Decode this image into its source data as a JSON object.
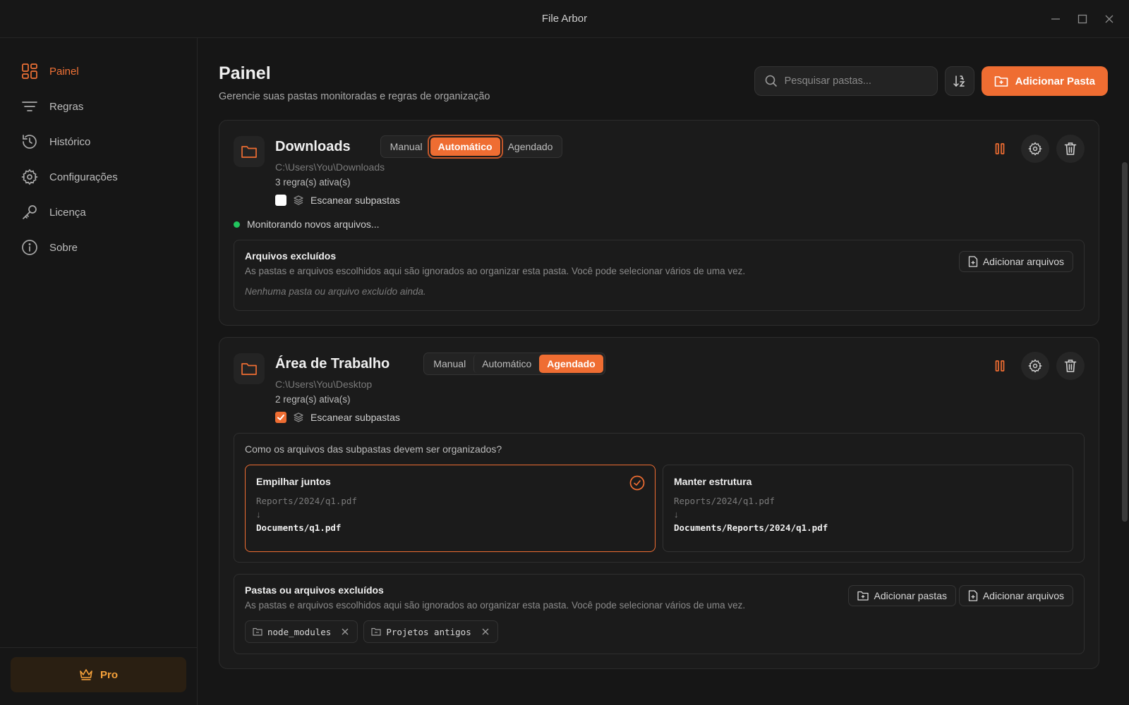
{
  "window": {
    "title": "File Arbor"
  },
  "sidebar": {
    "items": [
      {
        "label": "Painel",
        "icon": "dashboard-icon",
        "active": true
      },
      {
        "label": "Regras",
        "icon": "filter-icon"
      },
      {
        "label": "Histórico",
        "icon": "history-icon"
      },
      {
        "label": "Configurações",
        "icon": "gear-icon"
      },
      {
        "label": "Licença",
        "icon": "key-icon"
      },
      {
        "label": "Sobre",
        "icon": "info-icon"
      }
    ],
    "pro_label": "Pro"
  },
  "header": {
    "title": "Painel",
    "subtitle": "Gerencie suas pastas monitoradas e regras de organização",
    "search_placeholder": "Pesquisar pastas...",
    "add_label": "Adicionar Pasta"
  },
  "modes": [
    "Manual",
    "Automático",
    "Agendado"
  ],
  "folders": [
    {
      "name": "Downloads",
      "active_mode": "Automático",
      "path": "C:\\Users\\You\\Downloads",
      "rules": "3 regra(s) ativa(s)",
      "scan_label": "Escanear subpastas",
      "scan_checked": false,
      "status": "Monitorando novos arquivos...",
      "excluded": {
        "title": "Arquivos excluídos",
        "desc": "As pastas e arquivos escolhidos aqui são ignorados ao organizar esta pasta. Você pode selecionar vários de uma vez.",
        "empty": "Nenhuma pasta ou arquivo excluído ainda.",
        "add_files": "Adicionar arquivos"
      }
    },
    {
      "name": "Área de Trabalho",
      "active_mode": "Agendado",
      "path": "C:\\Users\\You\\Desktop",
      "rules": "2 regra(s) ativa(s)",
      "scan_label": "Escanear subpastas",
      "scan_checked": true,
      "subfolder": {
        "question": "Como os arquivos das subpastas devem ser organizados?",
        "options": [
          {
            "title": "Empilhar juntos",
            "from": "Reports/2024/q1.pdf",
            "arrow": "↓",
            "to": "Documents/q1.pdf",
            "selected": true
          },
          {
            "title": "Manter estrutura",
            "from": "Reports/2024/q1.pdf",
            "arrow": "↓",
            "to": "Documents/Reports/2024/q1.pdf",
            "selected": false
          }
        ]
      },
      "excluded": {
        "title": "Pastas ou arquivos excluídos",
        "desc": "As pastas e arquivos escolhidos aqui são ignorados ao organizar esta pasta. Você pode selecionar vários de uma vez.",
        "add_folders": "Adicionar pastas",
        "add_files": "Adicionar arquivos",
        "chips": [
          "node_modules",
          "Projetos antigos"
        ]
      }
    }
  ],
  "colors": {
    "accent": "#ef6d32",
    "status_ok": "#22c55e",
    "pro": "#f5a13a"
  }
}
